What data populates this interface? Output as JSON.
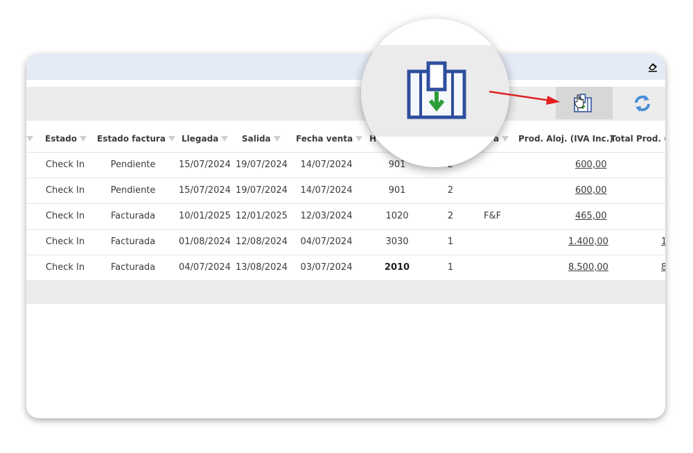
{
  "toolbar": {
    "export_icon": "export-grid-download-icon",
    "refresh_icon": "refresh-icon",
    "clear_icon": "eraser-icon"
  },
  "table": {
    "columns": [
      "Estado",
      "Estado factura",
      "Llegada",
      "Salida",
      "Fecha venta",
      "H",
      "a",
      "Prod. Aloj. (IVA Inc.)",
      "Total Prod. (I"
    ],
    "rows": [
      {
        "estado": "Check In",
        "estado_factura": "Pendiente",
        "llegada": "15/07/2024",
        "salida": "19/07/2024",
        "fecha_venta": "14/07/2024",
        "hab": "901",
        "pax": "2",
        "tarifa": "",
        "prod_aloj": "600,00",
        "total_prod": ""
      },
      {
        "estado": "Check In",
        "estado_factura": "Pendiente",
        "llegada": "15/07/2024",
        "salida": "19/07/2024",
        "fecha_venta": "14/07/2024",
        "hab": "901",
        "pax": "2",
        "tarifa": "",
        "prod_aloj": "600,00",
        "total_prod": ""
      },
      {
        "estado": "Check In",
        "estado_factura": "Facturada",
        "llegada": "10/01/2025",
        "salida": "12/01/2025",
        "fecha_venta": "12/03/2024",
        "hab": "1020",
        "pax": "2",
        "tarifa": "F&F",
        "prod_aloj": "465,00",
        "total_prod": ""
      },
      {
        "estado": "Check In",
        "estado_factura": "Facturada",
        "llegada": "01/08/2024",
        "salida": "12/08/2024",
        "fecha_venta": "04/07/2024",
        "hab": "3030",
        "pax": "1",
        "tarifa": "",
        "prod_aloj": "1.400,00",
        "total_prod": "1"
      },
      {
        "estado": "Check In",
        "estado_factura": "Facturada",
        "llegada": "04/07/2024",
        "salida": "13/08/2024",
        "fecha_venta": "03/07/2024",
        "hab": "2010",
        "pax": "1",
        "tarifa": "",
        "prod_aloj": "8.500,00",
        "total_prod": "8"
      }
    ]
  },
  "colors": {
    "accent_blue": "#2f4f9e",
    "arrow_red": "#e02020",
    "download_green": "#2e9e3a"
  }
}
